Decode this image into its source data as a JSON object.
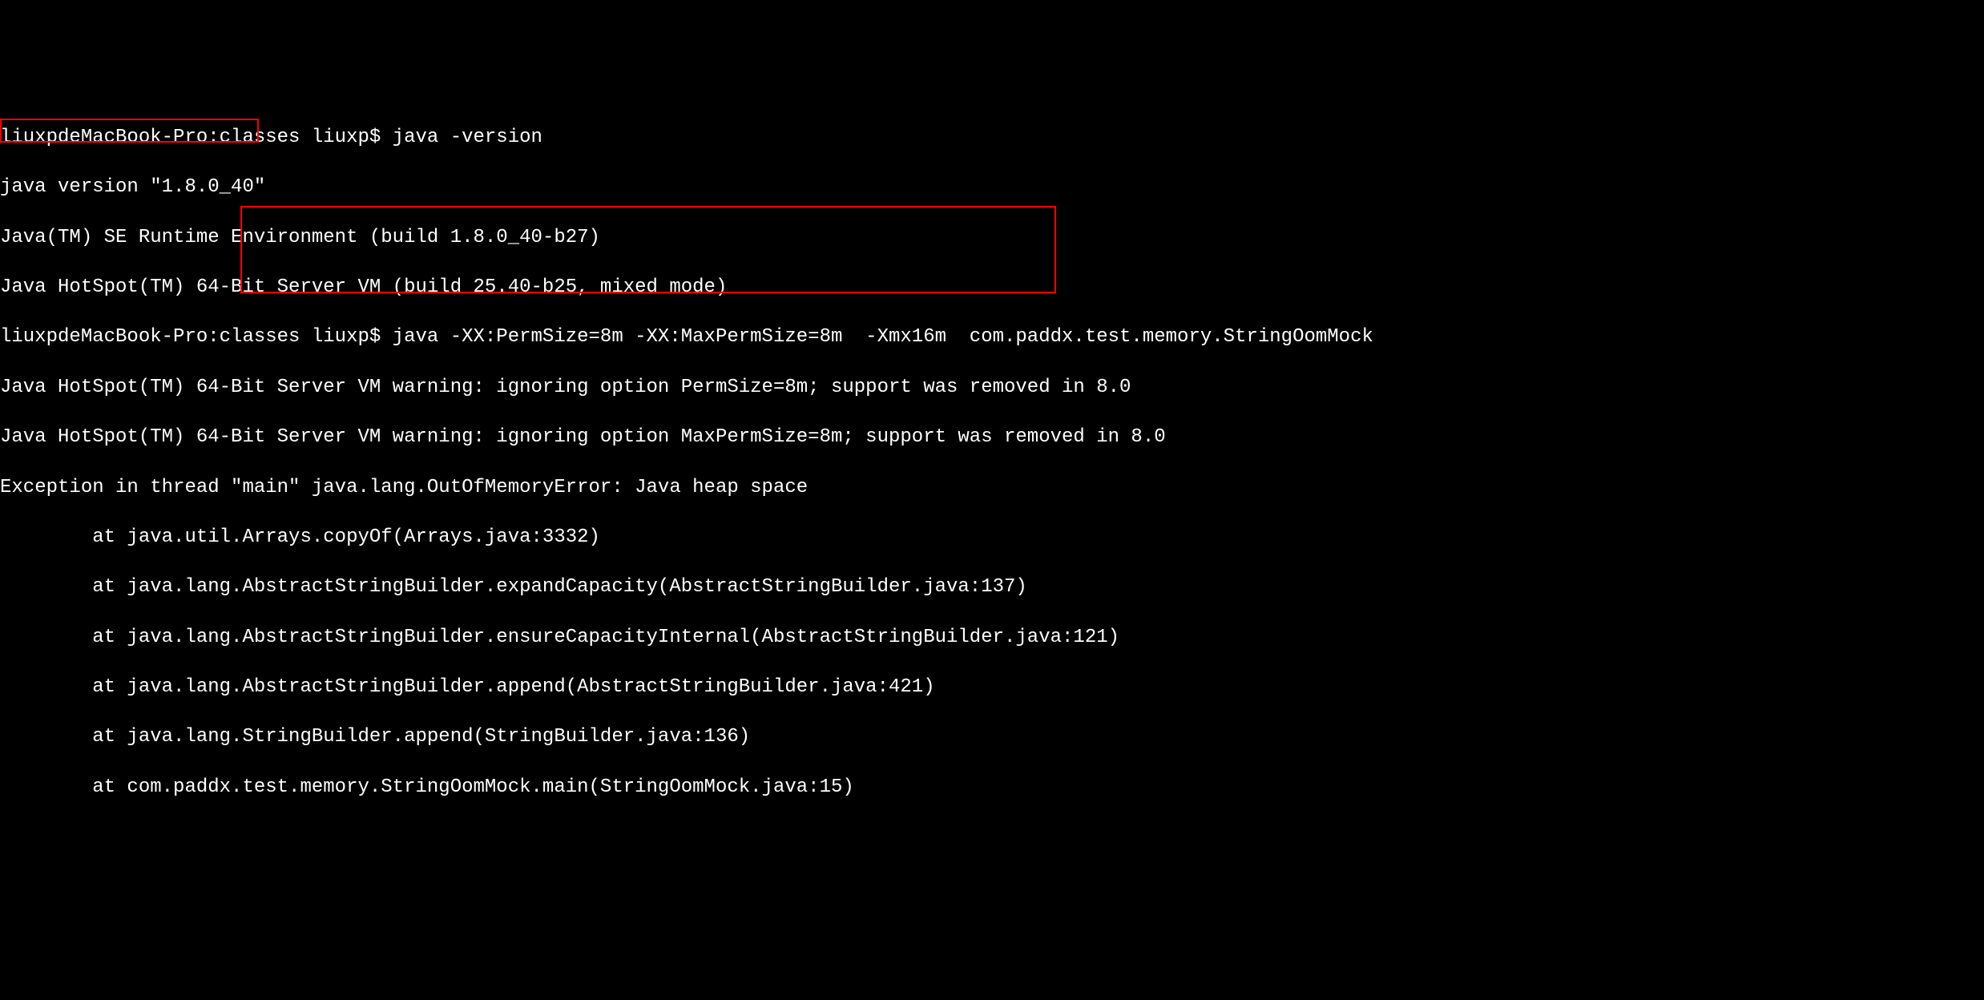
{
  "terminal": {
    "lines": [
      "liuxpdeMacBook-Pro:classes liuxp$ java -version",
      "java version \"1.8.0_40\"",
      "Java(TM) SE Runtime Environment (build 1.8.0_40-b27)",
      "Java HotSpot(TM) 64-Bit Server VM (build 25.40-b25, mixed mode)",
      "liuxpdeMacBook-Pro:classes liuxp$ java -XX:PermSize=8m -XX:MaxPermSize=8m  -Xmx16m  com.paddx.test.memory.StringOomMock",
      "Java HotSpot(TM) 64-Bit Server VM warning: ignoring option PermSize=8m; support was removed in 8.0",
      "Java HotSpot(TM) 64-Bit Server VM warning: ignoring option MaxPermSize=8m; support was removed in 8.0",
      "Exception in thread \"main\" java.lang.OutOfMemoryError: Java heap space",
      "        at java.util.Arrays.copyOf(Arrays.java:3332)",
      "        at java.lang.AbstractStringBuilder.expandCapacity(AbstractStringBuilder.java:137)",
      "        at java.lang.AbstractStringBuilder.ensureCapacityInternal(AbstractStringBuilder.java:121)",
      "        at java.lang.AbstractStringBuilder.append(AbstractStringBuilder.java:421)",
      "        at java.lang.StringBuilder.append(StringBuilder.java:136)",
      "        at com.paddx.test.memory.StringOomMock.main(StringOomMock.java:15)"
    ]
  }
}
